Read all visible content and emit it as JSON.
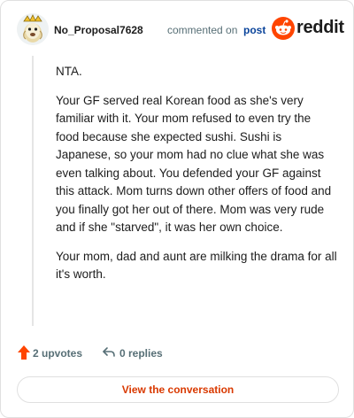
{
  "header": {
    "author": "No_Proposal7628",
    "action": "commented on",
    "post_link": "post",
    "brand": "reddit",
    "brand_color": "#ff4500"
  },
  "comment": {
    "paragraphs": [
      "NTA.",
      "Your GF served real Korean food as she's very familiar with it. Your mom refused to even try the food because she expected sushi. Sushi is Japanese, so your mom had no clue what she was even talking about. You defended your GF against this attack. Mom turns down other offers of food and you finally got her out of there. Mom was very rude and if she \"starved\", it was her own choice.",
      "Your mom, dad and aunt are milking the drama for all it's worth."
    ]
  },
  "footer": {
    "upvotes": "2 upvotes",
    "replies": "0 replies",
    "upvote_color": "#ff4500"
  },
  "cta": {
    "label": "View the conversation"
  },
  "icons": [
    "avatar-icon",
    "reddit-logo-icon",
    "upvote-arrow-icon",
    "reply-arrow-icon"
  ]
}
